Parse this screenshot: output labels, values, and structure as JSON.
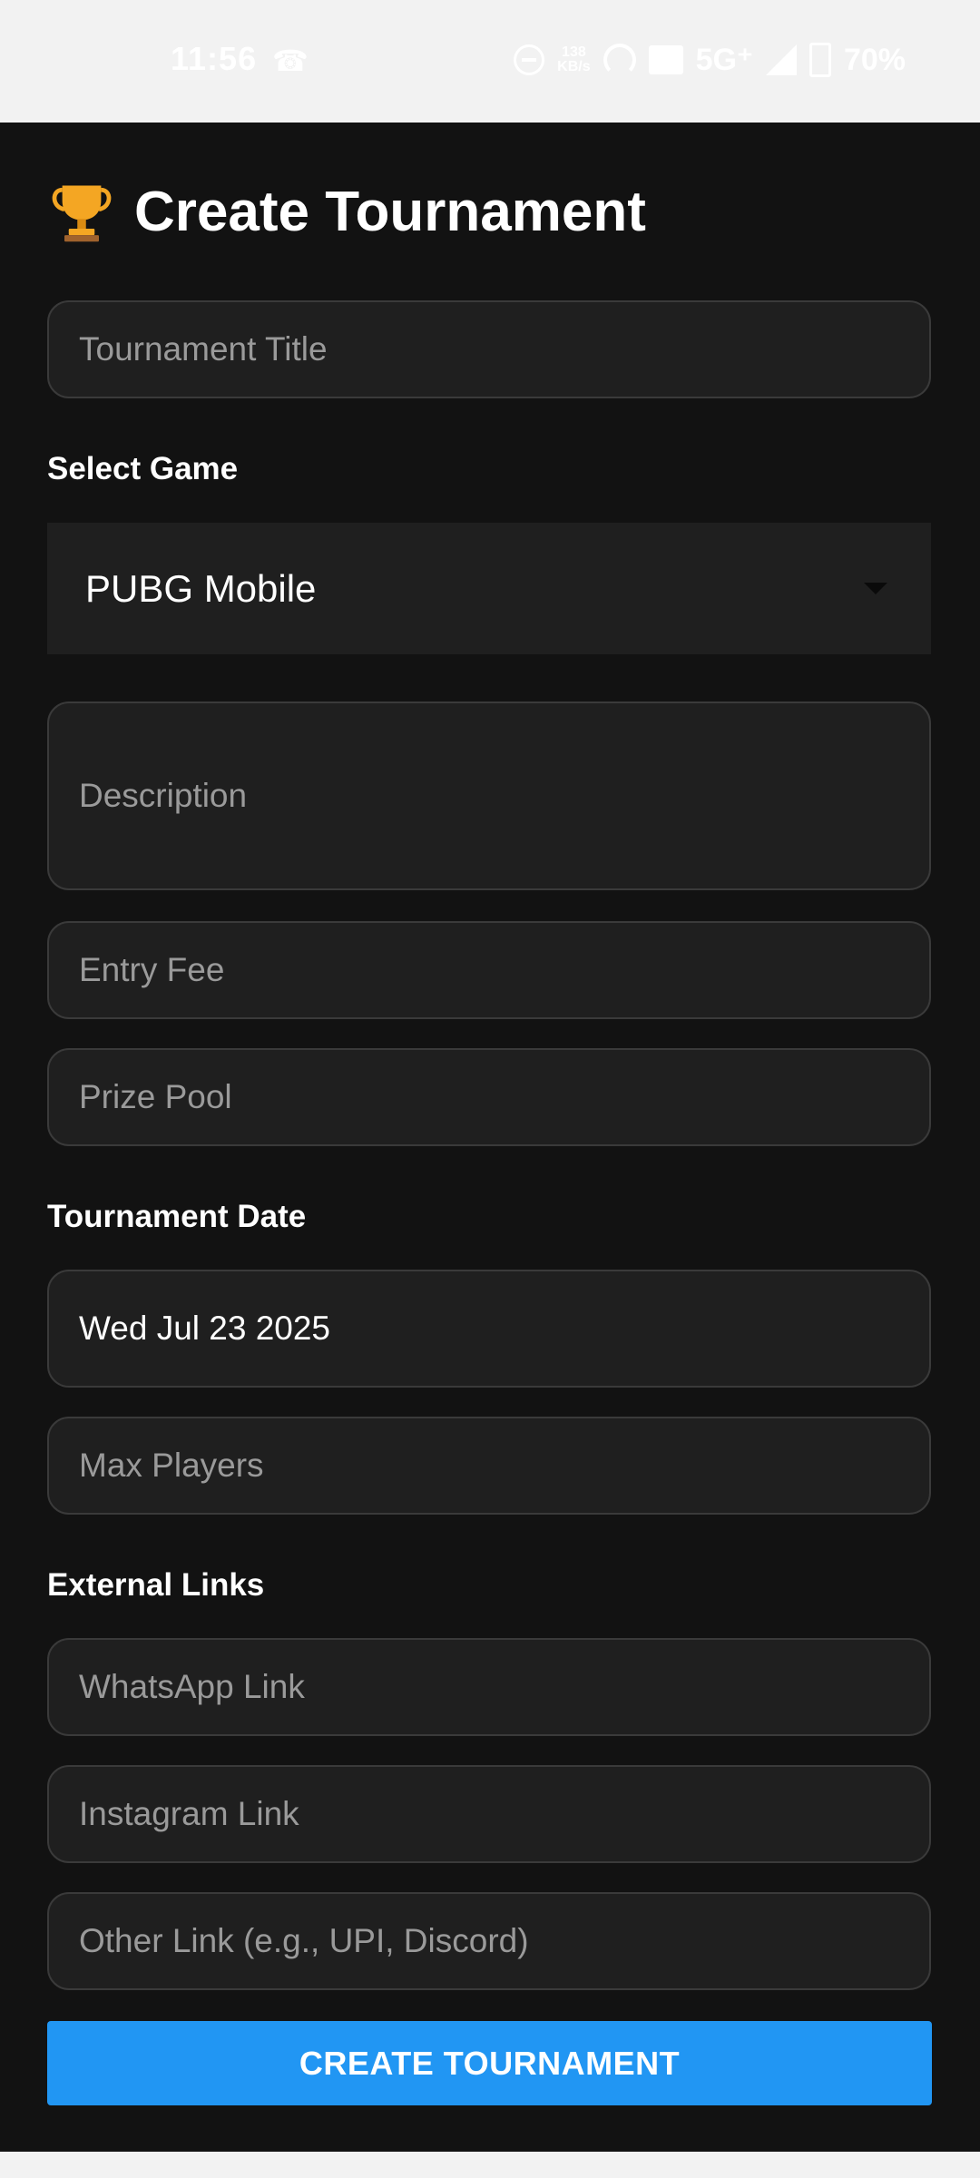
{
  "status_bar": {
    "time": "11:56",
    "net_speed_value": "138",
    "net_speed_unit": "KB/s",
    "network": "5G⁺",
    "battery": "70%",
    "icons": [
      "call-icon",
      "dnd-icon",
      "hotspot-icon",
      "vowifi-icon",
      "signal-icon",
      "battery-icon"
    ]
  },
  "header": {
    "icon": "trophy-icon",
    "title": "Create Tournament"
  },
  "form": {
    "title_placeholder": "Tournament Title",
    "game_label": "Select Game",
    "game_selected": "PUBG Mobile",
    "description_placeholder": "Description",
    "entry_fee_placeholder": "Entry Fee",
    "prize_pool_placeholder": "Prize Pool",
    "date_label": "Tournament Date",
    "date_value": "Wed Jul 23 2025",
    "max_players_placeholder": "Max Players",
    "links_label": "External Links",
    "whatsapp_placeholder": "WhatsApp Link",
    "instagram_placeholder": "Instagram Link",
    "other_link_placeholder": "Other Link (e.g., UPI, Discord)",
    "submit_label": "CREATE TOURNAMENT"
  },
  "colors": {
    "background": "#121212",
    "field_background": "#1f1f1f",
    "field_border": "#3a3a3a",
    "accent": "#2196f3",
    "placeholder": "#9a9a9a",
    "text": "#ffffff"
  }
}
